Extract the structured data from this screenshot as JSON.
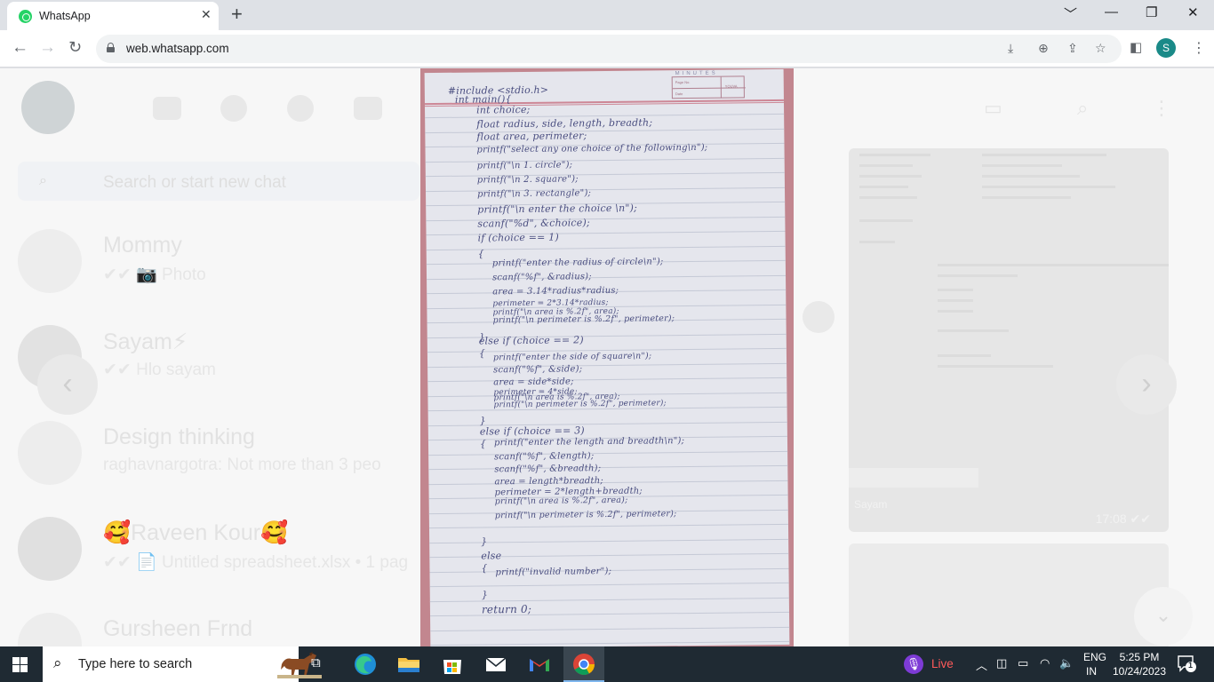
{
  "browser": {
    "tab_title": "WhatsApp",
    "tab_close": "✕",
    "new_tab": "+",
    "url": "web.whatsapp.com",
    "profile_initial": "S",
    "window_controls": [
      "﹀",
      "—",
      "❐",
      "✕"
    ]
  },
  "whatsapp": {
    "search_placeholder": "Search or start new chat",
    "chats": [
      {
        "name": "Mommy",
        "message": "✔✔ 📷 Photo"
      },
      {
        "name": "Sayam⚡",
        "message": "✔✔ Hlo sayam"
      },
      {
        "name": "Design thinking",
        "message": "raghavnargotra: Not more than 3 peo"
      },
      {
        "name": "🥰Raveen Kour🥰",
        "message": "✔✔ 📄 Untitled spreadsheet.xlsx • 1 pag"
      },
      {
        "name": "Gursheen Frnd",
        "message": ""
      }
    ],
    "thumb_time": "17:08 ✔✔",
    "thumb_label": "Sayam"
  },
  "notebook": {
    "brand": "MINUTES",
    "page_no_label": "Page No.",
    "date_label": "Date",
    "year_label": "YOUVA",
    "lines": [
      "#include <stdio.h>",
      "int main(){",
      "int choice;",
      "float radius, side, length, breadth;",
      "float area, perimeter;",
      "printf(\"select any one choice of the following\\n\");",
      "printf(\"\\n 1. circle\");",
      "printf(\"\\n 2. square\");",
      "printf(\"\\n 3. rectangle\");",
      "printf(\"\\n enter the choice \\n\");",
      "scanf(\"%d\", &choice);",
      "if (choice == 1)",
      "{",
      "printf(\"enter the radius of circle\\n\");",
      "scanf(\"%f\", &radius);",
      "area = 3.14*radius*radius;",
      "perimeter = 2*3.14*radius;",
      "printf(\"\\n area is %.2f\", area);",
      "printf(\"\\n perimeter is %.2f\", perimeter);",
      "}",
      "else if (choice == 2)",
      "{",
      "printf(\"enter the side of square\\n\");",
      "scanf(\"%f\", &side);",
      "area = side*side;",
      "perimeter = 4*side;",
      "printf(\"\\n area is %.2f\", area);",
      "printf(\"\\n perimeter is %.2f\", perimeter);",
      "}",
      "else if (choice == 3)",
      "{",
      "printf(\"enter the length and breadth\\n\");",
      "scanf(\"%f\", &length);",
      "scanf(\"%f\", &breadth);",
      "area = length*breadth;",
      "perimeter = 2*length+breadth;",
      "printf(\"\\n area is %.2f\", area);",
      "printf(\"\\n perimeter is %.2f\", perimeter);",
      "}",
      "else",
      "{",
      "printf(\"invalid number\");",
      "}",
      "return 0;"
    ]
  },
  "taskbar": {
    "search_placeholder": "Type here to search",
    "live_label": "Live",
    "lang_line1": "ENG",
    "lang_line2": "IN",
    "time": "5:25 PM",
    "date": "10/24/2023",
    "notification_count": "1"
  }
}
